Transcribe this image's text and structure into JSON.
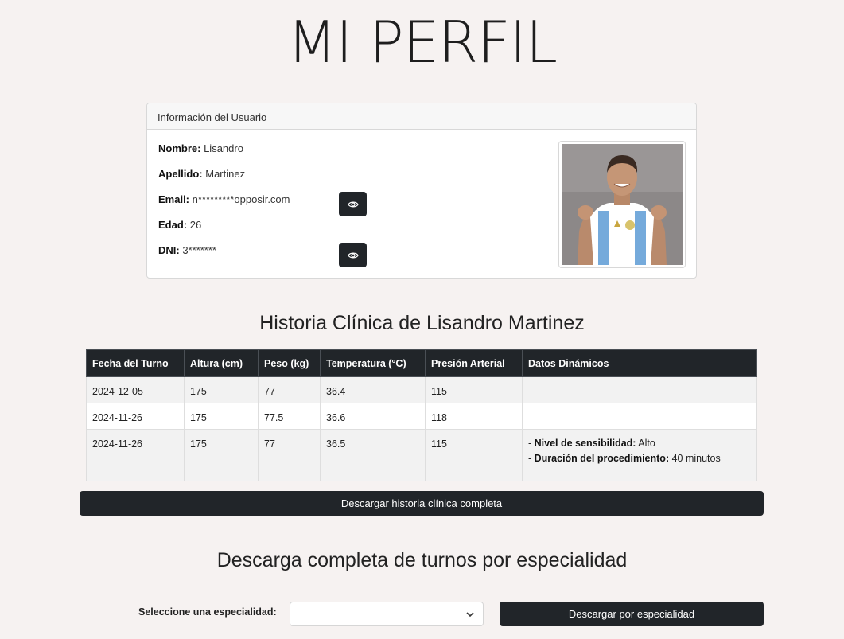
{
  "page": {
    "title": "MI PERFIL"
  },
  "user_card": {
    "header": "Información del Usuario",
    "fields": {
      "nombre": {
        "label": "Nombre:",
        "value": "Lisandro"
      },
      "apellido": {
        "label": "Apellido:",
        "value": "Martinez"
      },
      "email": {
        "label": "Email:",
        "value": "n*********opposir.com"
      },
      "edad": {
        "label": "Edad:",
        "value": "26"
      },
      "dni": {
        "label": "DNI:",
        "value": "3*******"
      }
    },
    "icons": {
      "reveal": "eye-icon"
    }
  },
  "history": {
    "title": "Historia Clínica de Lisandro Martinez",
    "columns": [
      "Fecha del Turno",
      "Altura (cm)",
      "Peso (kg)",
      "Temperatura (°C)",
      "Presión Arterial",
      "Datos Dinámicos"
    ],
    "rows": [
      {
        "fecha": "2024-12-05",
        "altura": "175",
        "peso": "77",
        "temperatura": "36.4",
        "presion": "115",
        "dinamicos": []
      },
      {
        "fecha": "2024-11-26",
        "altura": "175",
        "peso": "77.5",
        "temperatura": "36.6",
        "presion": "118",
        "dinamicos": []
      },
      {
        "fecha": "2024-11-26",
        "altura": "175",
        "peso": "77",
        "temperatura": "36.5",
        "presion": "115",
        "dinamicos": [
          {
            "prefix": "- ",
            "key": "Nivel de sensibilidad:",
            "value": " Alto"
          },
          {
            "prefix": "- ",
            "key": "Duración del procedimiento:",
            "value": " 40 minutos"
          }
        ]
      }
    ],
    "download_label": "Descargar historia clínica completa"
  },
  "specialty": {
    "title": "Descarga completa de turnos por especialidad",
    "select_label": "Seleccione una especialidad:",
    "select_value": "",
    "download_label": "Descargar por especialidad"
  },
  "colors": {
    "dark": "#212529",
    "background": "#f6f2f1",
    "shirt_blue": "#75aadb"
  }
}
